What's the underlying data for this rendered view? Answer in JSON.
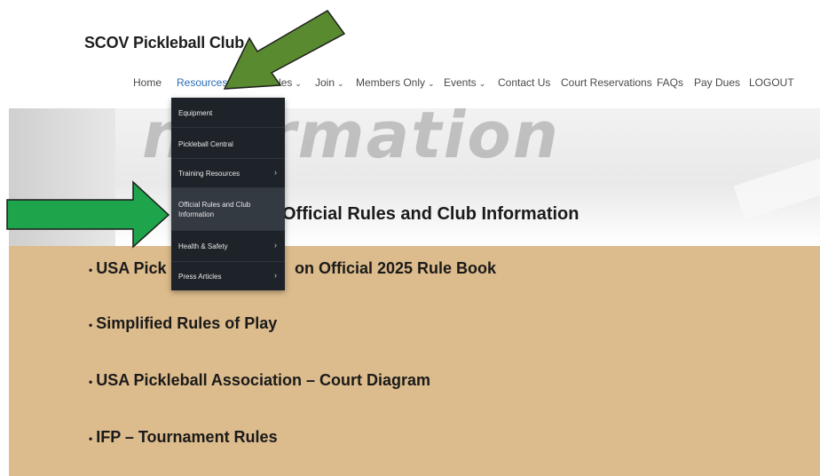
{
  "site": {
    "title": "SCOV Pickleball Club"
  },
  "nav": {
    "items": [
      {
        "label": "Home",
        "has_caret": false
      },
      {
        "label": "Resources",
        "has_caret": true,
        "active": true
      },
      {
        "label": "Schedules",
        "visible_label": "edules",
        "has_caret": true
      },
      {
        "label": "Join",
        "has_caret": true
      },
      {
        "label": "Members Only",
        "has_caret": true
      },
      {
        "label": "Events",
        "has_caret": true
      },
      {
        "label": "Contact Us",
        "has_caret": false
      },
      {
        "label": "Court Reservations",
        "has_caret": false
      },
      {
        "label": "FAQs",
        "has_caret": false
      },
      {
        "label": "Pay Dues",
        "has_caret": false
      },
      {
        "label": "LOGOUT",
        "has_caret": false
      }
    ],
    "caret": "⌄"
  },
  "dropdown": {
    "items": [
      {
        "label": "Equipment",
        "submenu": false
      },
      {
        "label": "Pickleball Central",
        "submenu": false
      },
      {
        "label": "Training Resources",
        "submenu": true
      },
      {
        "label": "Official Rules and Club",
        "label2": "Information",
        "submenu": false,
        "highlighted": true
      },
      {
        "label": "Health & Safety",
        "submenu": true
      },
      {
        "label": "Press Articles",
        "submenu": true
      }
    ],
    "submenu_glyph": "›"
  },
  "hero": {
    "watermark_text": "nformation",
    "heading": "Official Rules and Club Information"
  },
  "links": [
    {
      "visible_start": "USA Pick",
      "visible_end": "on Official 2025 Rule Book"
    },
    {
      "text": "Simplified Rules of Play"
    },
    {
      "text": "USA Pickleball Association – Court Diagram"
    },
    {
      "text": "IFP – Tournament Rules"
    }
  ],
  "colors": {
    "arrow_dark_green": "#5a8a2f",
    "arrow_bright_green": "#1ea44a",
    "hero_tan": "#dcbb8c",
    "dropdown_bg": "#1e2329",
    "nav_active": "#2a6db5"
  }
}
